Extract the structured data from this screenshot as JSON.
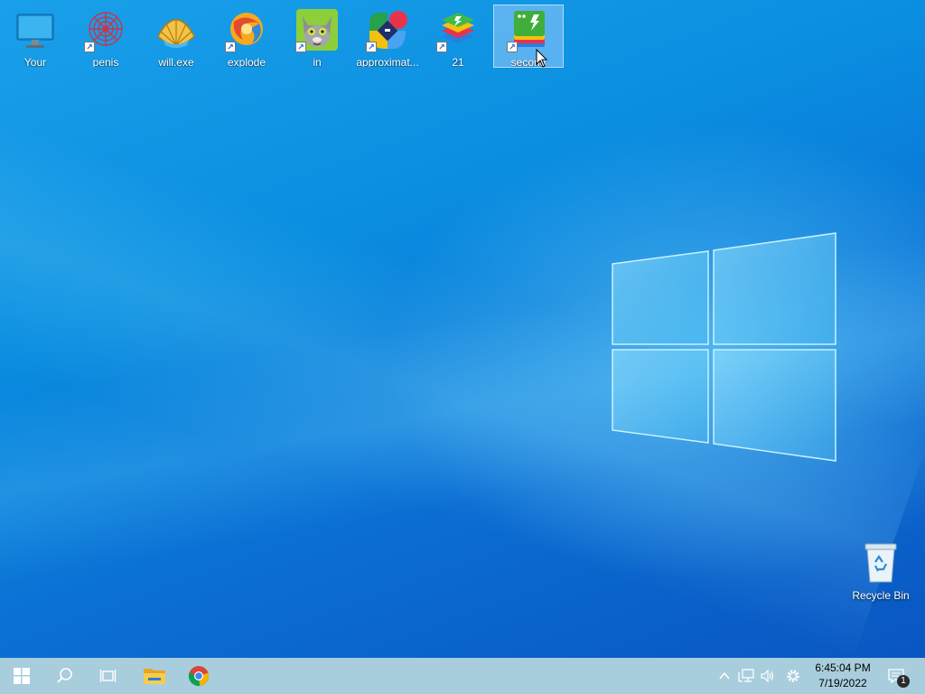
{
  "desktop_icons": [
    {
      "label": "Your",
      "icon": "monitor-icon",
      "shortcut": false,
      "selected": false
    },
    {
      "label": "penis",
      "icon": "red-spiral-icon",
      "shortcut": true,
      "selected": false
    },
    {
      "label": "will.exe",
      "icon": "shell-icon",
      "shortcut": false,
      "selected": false
    },
    {
      "label": "explode",
      "icon": "swirl-orb-icon",
      "shortcut": true,
      "selected": false
    },
    {
      "label": "in",
      "icon": "talking-tom-cat-icon",
      "shortcut": true,
      "selected": false
    },
    {
      "label": "approximat...",
      "icon": "multicolor-app-icon",
      "shortcut": true,
      "selected": false
    },
    {
      "label": "21",
      "icon": "bluestacks-icon",
      "shortcut": true,
      "selected": false
    },
    {
      "label": "second",
      "icon": "green-app-stack-icon",
      "shortcut": true,
      "selected": true
    }
  ],
  "recycle_bin": {
    "label": "Recycle Bin"
  },
  "taskbar": {
    "pinned": [
      "start-icon",
      "search-icon",
      "task-view-icon",
      "file-explorer-icon",
      "chrome-icon"
    ],
    "tray": {
      "time": "6:45:04 PM",
      "date": "7/19/2022",
      "notification_count": "1"
    }
  },
  "colors": {
    "taskbar": "#a8cddd",
    "desktop_accent": "#0b78dc",
    "selection": "#b4d7ff"
  }
}
